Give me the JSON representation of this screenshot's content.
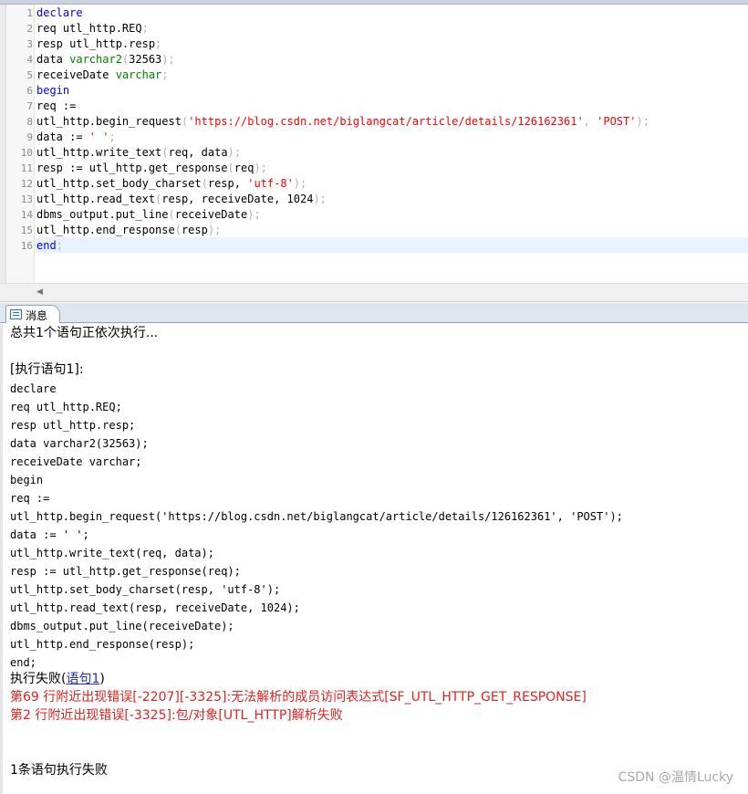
{
  "editor": {
    "lines": [
      {
        "n": "1",
        "parts": [
          {
            "t": "declare",
            "c": "kw"
          }
        ]
      },
      {
        "n": "2",
        "parts": [
          {
            "t": "req utl_http.REQ",
            "c": ""
          },
          {
            "t": ";",
            "c": "pu"
          }
        ]
      },
      {
        "n": "3",
        "parts": [
          {
            "t": "resp utl_http.resp",
            "c": ""
          },
          {
            "t": ";",
            "c": "pu"
          }
        ]
      },
      {
        "n": "4",
        "parts": [
          {
            "t": "data ",
            "c": ""
          },
          {
            "t": "varchar2",
            "c": "ty"
          },
          {
            "t": "(",
            "c": "pu"
          },
          {
            "t": "32563",
            "c": ""
          },
          {
            "t": ");",
            "c": "pu"
          }
        ]
      },
      {
        "n": "5",
        "parts": [
          {
            "t": "receiveDate ",
            "c": ""
          },
          {
            "t": "varchar",
            "c": "ty"
          },
          {
            "t": ";",
            "c": "pu"
          }
        ]
      },
      {
        "n": "6",
        "parts": [
          {
            "t": "begin",
            "c": "kw"
          }
        ]
      },
      {
        "n": "7",
        "parts": [
          {
            "t": "req :=",
            "c": ""
          }
        ]
      },
      {
        "n": "8",
        "parts": [
          {
            "t": "utl_http.begin_request",
            "c": ""
          },
          {
            "t": "(",
            "c": "pu"
          },
          {
            "t": "'https://blog.csdn.net/biglangcat/article/details/126162361'",
            "c": "st"
          },
          {
            "t": ", ",
            "c": "pu"
          },
          {
            "t": "'POST'",
            "c": "st"
          },
          {
            "t": ");",
            "c": "pu"
          }
        ]
      },
      {
        "n": "9",
        "parts": [
          {
            "t": "data := ",
            "c": ""
          },
          {
            "t": "' '",
            "c": "st"
          },
          {
            "t": ";",
            "c": "pu"
          }
        ]
      },
      {
        "n": "10",
        "parts": [
          {
            "t": "utl_http.write_text",
            "c": ""
          },
          {
            "t": "(",
            "c": "pu"
          },
          {
            "t": "req, data",
            "c": ""
          },
          {
            "t": ");",
            "c": "pu"
          }
        ]
      },
      {
        "n": "11",
        "parts": [
          {
            "t": "resp := utl_http.get_response",
            "c": ""
          },
          {
            "t": "(",
            "c": "pu"
          },
          {
            "t": "req",
            "c": ""
          },
          {
            "t": ");",
            "c": "pu"
          }
        ]
      },
      {
        "n": "12",
        "parts": [
          {
            "t": "utl_http.set_body_charset",
            "c": ""
          },
          {
            "t": "(",
            "c": "pu"
          },
          {
            "t": "resp, ",
            "c": ""
          },
          {
            "t": "'utf-8'",
            "c": "st"
          },
          {
            "t": ");",
            "c": "pu"
          }
        ]
      },
      {
        "n": "13",
        "parts": [
          {
            "t": "utl_http.read_text",
            "c": ""
          },
          {
            "t": "(",
            "c": "pu"
          },
          {
            "t": "resp, receiveDate, 1024",
            "c": ""
          },
          {
            "t": ");",
            "c": "pu"
          }
        ]
      },
      {
        "n": "14",
        "parts": [
          {
            "t": "dbms_output.put_line",
            "c": ""
          },
          {
            "t": "(",
            "c": "pu"
          },
          {
            "t": "receiveDate",
            "c": ""
          },
          {
            "t": ");",
            "c": "pu"
          }
        ]
      },
      {
        "n": "15",
        "parts": [
          {
            "t": "utl_http.end_response",
            "c": ""
          },
          {
            "t": "(",
            "c": "pu"
          },
          {
            "t": "resp",
            "c": ""
          },
          {
            "t": ");",
            "c": "pu"
          }
        ]
      },
      {
        "n": "16",
        "parts": [
          {
            "t": "end",
            "c": "kw"
          },
          {
            "t": ";",
            "c": "pu"
          }
        ]
      }
    ]
  },
  "panel": {
    "tab_label": "消息"
  },
  "messages": {
    "summary": "总共1个语句正依次执行...",
    "exec_label": "[执行语句1]:",
    "sql_lines": [
      "declare",
      "req utl_http.REQ;",
      "resp utl_http.resp;",
      "data varchar2(32563);",
      "receiveDate varchar;",
      "begin",
      "req :=",
      "utl_http.begin_request('https://blog.csdn.net/biglangcat/article/details/126162361', 'POST');",
      "data := ' ';",
      "utl_http.write_text(req, data);",
      "resp := utl_http.get_response(req);",
      "utl_http.set_body_charset(resp, 'utf-8');",
      "utl_http.read_text(resp, receiveDate, 1024);",
      "dbms_output.put_line(receiveDate);",
      "utl_http.end_response(resp);",
      "end;"
    ],
    "fail_prefix": "执行失败(",
    "fail_link": "语句1",
    "fail_suffix": ")",
    "error1": "第69 行附近出现错误[-2207][-3325]:无法解析的成员访问表达式[SF_UTL_HTTP_GET_RESPONSE]",
    "error2": "第2 行附近出现错误[-3325]:包/对象[UTL_HTTP]解析失败",
    "fail_count": "1条语句执行失败"
  },
  "watermark": "CSDN @温情Lucky"
}
